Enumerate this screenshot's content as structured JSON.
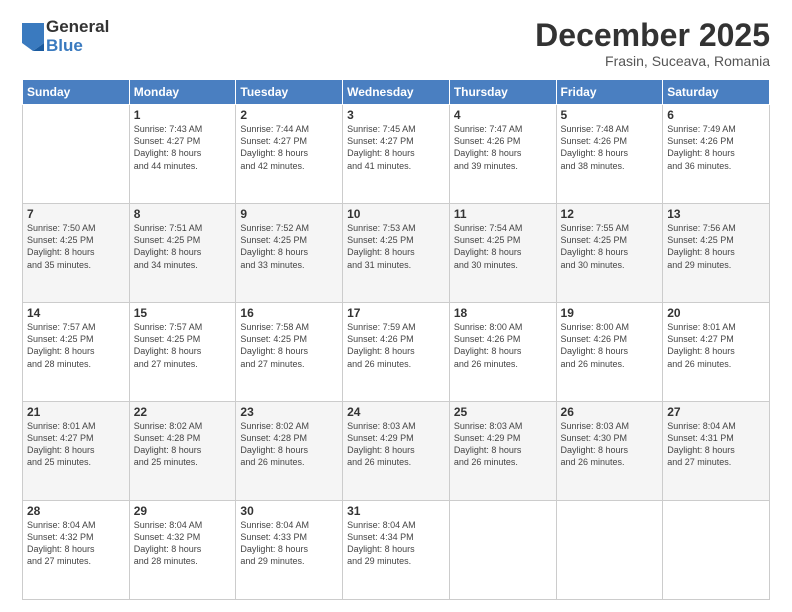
{
  "logo": {
    "general": "General",
    "blue": "Blue"
  },
  "title": "December 2025",
  "location": "Frasin, Suceava, Romania",
  "days_of_week": [
    "Sunday",
    "Monday",
    "Tuesday",
    "Wednesday",
    "Thursday",
    "Friday",
    "Saturday"
  ],
  "weeks": [
    [
      {
        "num": "",
        "info": ""
      },
      {
        "num": "1",
        "info": "Sunrise: 7:43 AM\nSunset: 4:27 PM\nDaylight: 8 hours\nand 44 minutes."
      },
      {
        "num": "2",
        "info": "Sunrise: 7:44 AM\nSunset: 4:27 PM\nDaylight: 8 hours\nand 42 minutes."
      },
      {
        "num": "3",
        "info": "Sunrise: 7:45 AM\nSunset: 4:27 PM\nDaylight: 8 hours\nand 41 minutes."
      },
      {
        "num": "4",
        "info": "Sunrise: 7:47 AM\nSunset: 4:26 PM\nDaylight: 8 hours\nand 39 minutes."
      },
      {
        "num": "5",
        "info": "Sunrise: 7:48 AM\nSunset: 4:26 PM\nDaylight: 8 hours\nand 38 minutes."
      },
      {
        "num": "6",
        "info": "Sunrise: 7:49 AM\nSunset: 4:26 PM\nDaylight: 8 hours\nand 36 minutes."
      }
    ],
    [
      {
        "num": "7",
        "info": "Sunrise: 7:50 AM\nSunset: 4:25 PM\nDaylight: 8 hours\nand 35 minutes."
      },
      {
        "num": "8",
        "info": "Sunrise: 7:51 AM\nSunset: 4:25 PM\nDaylight: 8 hours\nand 34 minutes."
      },
      {
        "num": "9",
        "info": "Sunrise: 7:52 AM\nSunset: 4:25 PM\nDaylight: 8 hours\nand 33 minutes."
      },
      {
        "num": "10",
        "info": "Sunrise: 7:53 AM\nSunset: 4:25 PM\nDaylight: 8 hours\nand 31 minutes."
      },
      {
        "num": "11",
        "info": "Sunrise: 7:54 AM\nSunset: 4:25 PM\nDaylight: 8 hours\nand 30 minutes."
      },
      {
        "num": "12",
        "info": "Sunrise: 7:55 AM\nSunset: 4:25 PM\nDaylight: 8 hours\nand 30 minutes."
      },
      {
        "num": "13",
        "info": "Sunrise: 7:56 AM\nSunset: 4:25 PM\nDaylight: 8 hours\nand 29 minutes."
      }
    ],
    [
      {
        "num": "14",
        "info": "Sunrise: 7:57 AM\nSunset: 4:25 PM\nDaylight: 8 hours\nand 28 minutes."
      },
      {
        "num": "15",
        "info": "Sunrise: 7:57 AM\nSunset: 4:25 PM\nDaylight: 8 hours\nand 27 minutes."
      },
      {
        "num": "16",
        "info": "Sunrise: 7:58 AM\nSunset: 4:25 PM\nDaylight: 8 hours\nand 27 minutes."
      },
      {
        "num": "17",
        "info": "Sunrise: 7:59 AM\nSunset: 4:26 PM\nDaylight: 8 hours\nand 26 minutes."
      },
      {
        "num": "18",
        "info": "Sunrise: 8:00 AM\nSunset: 4:26 PM\nDaylight: 8 hours\nand 26 minutes."
      },
      {
        "num": "19",
        "info": "Sunrise: 8:00 AM\nSunset: 4:26 PM\nDaylight: 8 hours\nand 26 minutes."
      },
      {
        "num": "20",
        "info": "Sunrise: 8:01 AM\nSunset: 4:27 PM\nDaylight: 8 hours\nand 26 minutes."
      }
    ],
    [
      {
        "num": "21",
        "info": "Sunrise: 8:01 AM\nSunset: 4:27 PM\nDaylight: 8 hours\nand 25 minutes."
      },
      {
        "num": "22",
        "info": "Sunrise: 8:02 AM\nSunset: 4:28 PM\nDaylight: 8 hours\nand 25 minutes."
      },
      {
        "num": "23",
        "info": "Sunrise: 8:02 AM\nSunset: 4:28 PM\nDaylight: 8 hours\nand 26 minutes."
      },
      {
        "num": "24",
        "info": "Sunrise: 8:03 AM\nSunset: 4:29 PM\nDaylight: 8 hours\nand 26 minutes."
      },
      {
        "num": "25",
        "info": "Sunrise: 8:03 AM\nSunset: 4:29 PM\nDaylight: 8 hours\nand 26 minutes."
      },
      {
        "num": "26",
        "info": "Sunrise: 8:03 AM\nSunset: 4:30 PM\nDaylight: 8 hours\nand 26 minutes."
      },
      {
        "num": "27",
        "info": "Sunrise: 8:04 AM\nSunset: 4:31 PM\nDaylight: 8 hours\nand 27 minutes."
      }
    ],
    [
      {
        "num": "28",
        "info": "Sunrise: 8:04 AM\nSunset: 4:32 PM\nDaylight: 8 hours\nand 27 minutes."
      },
      {
        "num": "29",
        "info": "Sunrise: 8:04 AM\nSunset: 4:32 PM\nDaylight: 8 hours\nand 28 minutes."
      },
      {
        "num": "30",
        "info": "Sunrise: 8:04 AM\nSunset: 4:33 PM\nDaylight: 8 hours\nand 29 minutes."
      },
      {
        "num": "31",
        "info": "Sunrise: 8:04 AM\nSunset: 4:34 PM\nDaylight: 8 hours\nand 29 minutes."
      },
      {
        "num": "",
        "info": ""
      },
      {
        "num": "",
        "info": ""
      },
      {
        "num": "",
        "info": ""
      }
    ]
  ]
}
